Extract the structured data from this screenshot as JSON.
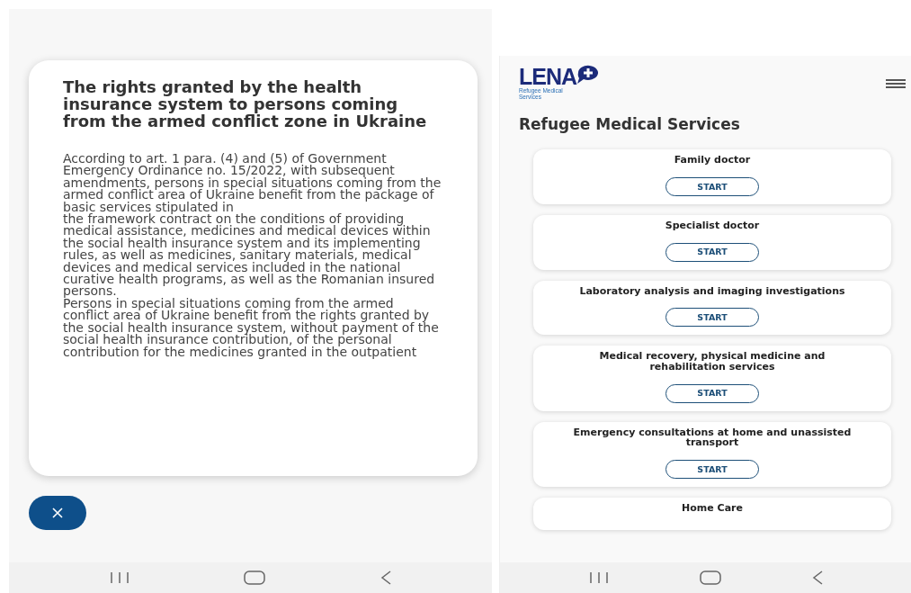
{
  "left_screen": {
    "dialog": {
      "title": "The rights granted by the health insurance system to persons coming from the armed conflict zone in Ukraine",
      "paragraphs": [
        "According to art. 1 para. (4) and (5) of Government Emergency Ordinance no. 15/2022, with subsequent amendments, persons in special situations coming from the armed conflict area of Ukraine benefit from the package of basic services stipulated in\nthe framework contract on the conditions of providing medical assistance, medicines and medical devices within the social health insurance system and its implementing rules, as well as medicines, sanitary materials, medical devices and medical services included in the national curative health programs, as well as the Romanian insured persons.",
        "Persons in special situations coming from the armed conflict area of Ukraine benefit from the rights granted by the social health insurance system, without payment of the social health insurance contribution, of the personal contribution for the medicines granted in the outpatient"
      ]
    }
  },
  "right_screen": {
    "logo": {
      "wordmark": "LENA",
      "tagline": "Refugee Medical Services"
    },
    "heading": "Refugee Medical Services",
    "services": [
      {
        "title": "Family doctor",
        "button": "START"
      },
      {
        "title": "Specialist doctor",
        "button": "START"
      },
      {
        "title": "Laboratory analysis and imaging investigations",
        "button": "START"
      },
      {
        "title": "Medical recovery, physical medicine and rehabilitation services",
        "button": "START"
      },
      {
        "title": "Emergency consultations at home and unassisted transport",
        "button": "START"
      },
      {
        "title": "Home Care"
      }
    ]
  }
}
